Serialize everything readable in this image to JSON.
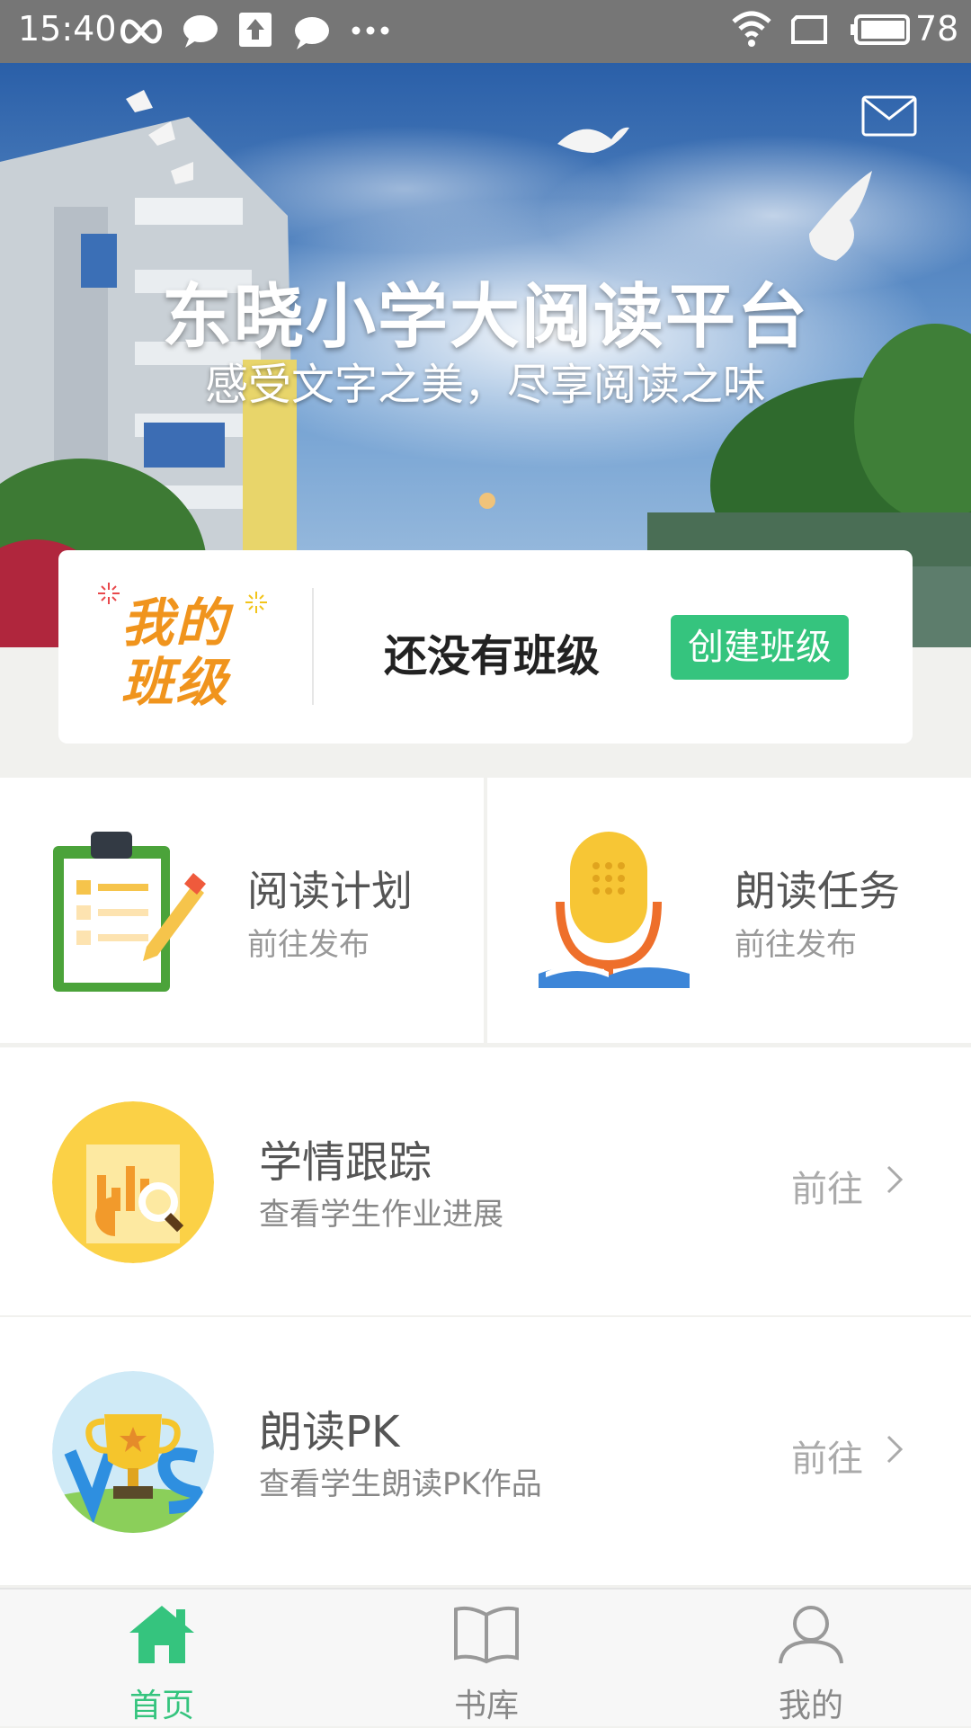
{
  "status_bar": {
    "time": "15:40",
    "battery": "78",
    "icons": [
      "loop-icon",
      "chat-icon",
      "upload-icon",
      "chat-icon",
      "more-dots-icon",
      "wifi-icon",
      "screen-icon",
      "battery-icon"
    ]
  },
  "banner": {
    "title": "东晓小学大阅读平台",
    "subtitle": "感受文字之美，尽享阅读之味",
    "mail_icon": "mail-icon"
  },
  "class_card": {
    "badge": "我的班级",
    "empty_text": "还没有班级",
    "create_button": "创建班级"
  },
  "features": [
    {
      "title": "阅读计划",
      "subtitle": "前往发布",
      "icon": "clipboard-pencil-icon"
    },
    {
      "title": "朗读任务",
      "subtitle": "前往发布",
      "icon": "microphone-book-icon"
    }
  ],
  "rows": [
    {
      "title": "学情跟踪",
      "subtitle": "查看学生作业进展",
      "action": "前往",
      "icon": "chart-magnifier-icon"
    },
    {
      "title": "朗读PK",
      "subtitle": "查看学生朗读PK作品",
      "action": "前往",
      "icon": "trophy-vs-icon"
    }
  ],
  "bottom_nav": [
    {
      "label": "首页",
      "icon": "home-icon",
      "active": true
    },
    {
      "label": "书库",
      "icon": "book-icon",
      "active": false
    },
    {
      "label": "我的",
      "icon": "user-icon",
      "active": false
    }
  ],
  "colors": {
    "accent_green": "#35c47e",
    "badge_orange": "#f0941d",
    "status_bar": "#767676"
  }
}
